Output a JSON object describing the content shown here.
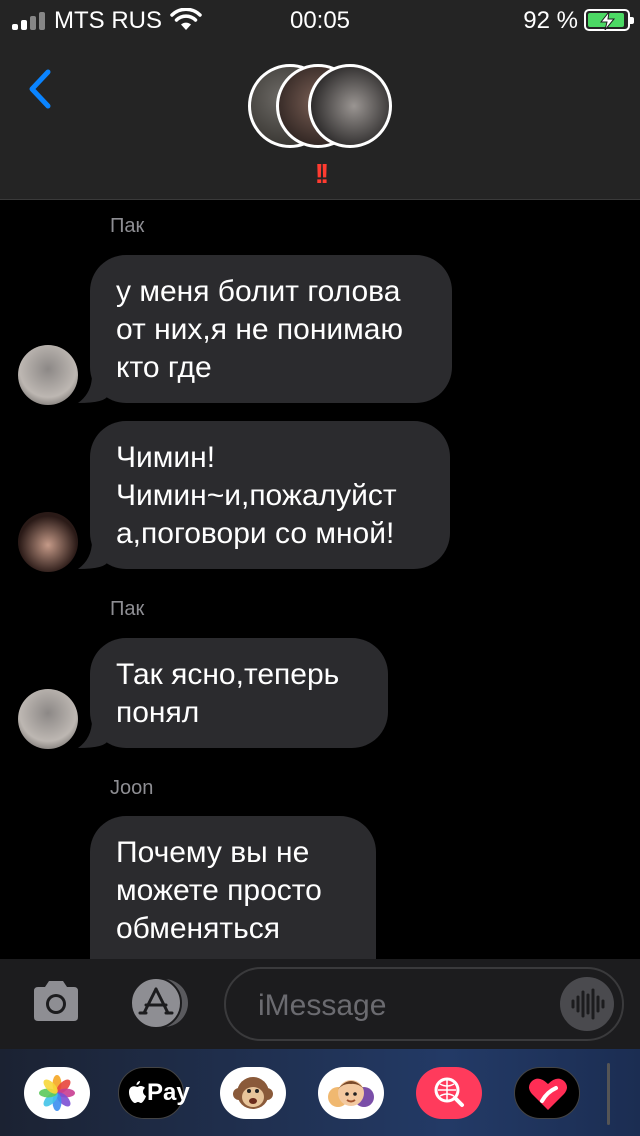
{
  "status": {
    "carrier": "MTS RUS",
    "time": "00:05",
    "battery": "92 %",
    "battery_level": 0.92
  },
  "header": {
    "urgent_mark": "!!"
  },
  "messages": [
    {
      "sender": "Пак",
      "text": "у меня болит голова\nот них,я не понимаю\nкто где"
    },
    {
      "sender": "",
      "text": "Чимин!\nЧимин~и,пожалуйст\nа,поговори со мной!"
    },
    {
      "sender": "Пак",
      "text": "Так ясно,теперь\nпонял"
    },
    {
      "sender": "Joon",
      "text": "Почему вы не\nможете просто\nобменяться\nномерами"
    }
  ],
  "input": {
    "placeholder": "iMessage"
  },
  "drawer": {
    "apple_pay": "Pay"
  },
  "colors": {
    "accent": "#0a84ff",
    "bubble": "#2b2b2e",
    "urgent": "#ff3b30",
    "battery": "#4cd964"
  }
}
